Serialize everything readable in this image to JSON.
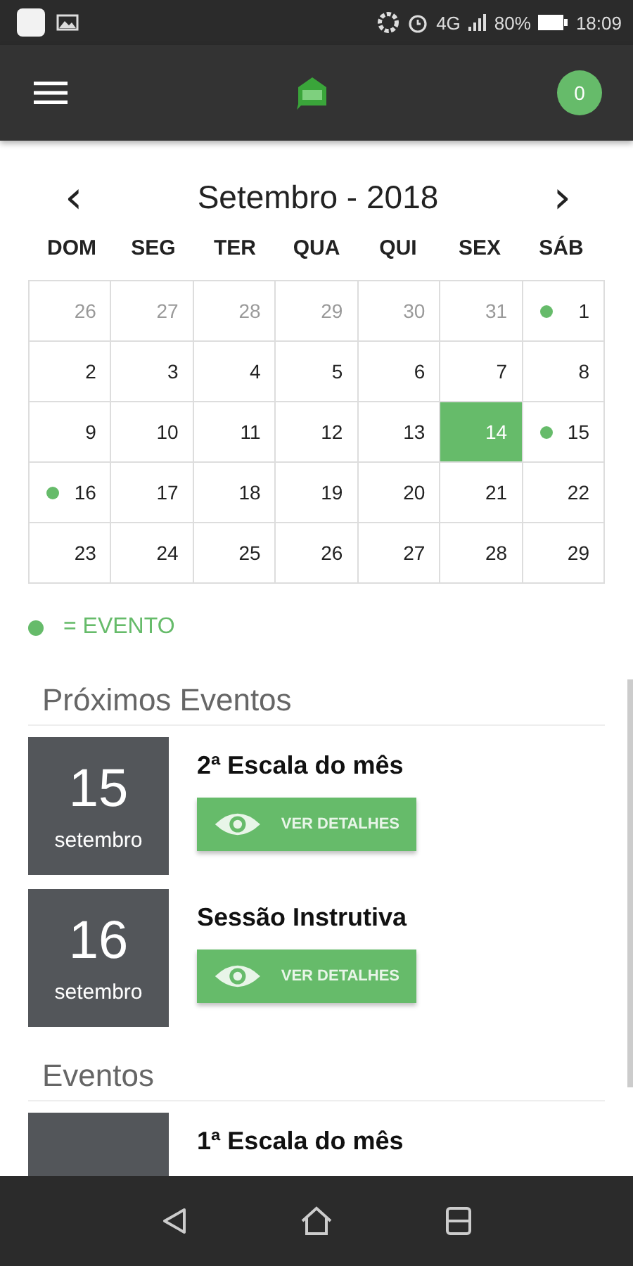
{
  "status_bar": {
    "network": "4G",
    "battery": "80%",
    "time": "18:09"
  },
  "app_bar": {
    "badge": "0"
  },
  "calendar": {
    "title": "Setembro - 2018",
    "prev": "‹",
    "next": "›",
    "weekdays": [
      "DOM",
      "SEG",
      "TER",
      "QUA",
      "QUI",
      "SEX",
      "SÁB"
    ],
    "weeks": [
      [
        {
          "day": "26",
          "muted": true,
          "selected": false,
          "event": false
        },
        {
          "day": "27",
          "muted": true,
          "selected": false,
          "event": false
        },
        {
          "day": "28",
          "muted": true,
          "selected": false,
          "event": false
        },
        {
          "day": "29",
          "muted": true,
          "selected": false,
          "event": false
        },
        {
          "day": "30",
          "muted": true,
          "selected": false,
          "event": false
        },
        {
          "day": "31",
          "muted": true,
          "selected": false,
          "event": false
        },
        {
          "day": "1",
          "muted": false,
          "selected": false,
          "event": true
        }
      ],
      [
        {
          "day": "2",
          "muted": false,
          "selected": false,
          "event": false
        },
        {
          "day": "3",
          "muted": false,
          "selected": false,
          "event": false
        },
        {
          "day": "4",
          "muted": false,
          "selected": false,
          "event": false
        },
        {
          "day": "5",
          "muted": false,
          "selected": false,
          "event": false
        },
        {
          "day": "6",
          "muted": false,
          "selected": false,
          "event": false
        },
        {
          "day": "7",
          "muted": false,
          "selected": false,
          "event": false
        },
        {
          "day": "8",
          "muted": false,
          "selected": false,
          "event": false
        }
      ],
      [
        {
          "day": "9",
          "muted": false,
          "selected": false,
          "event": false
        },
        {
          "day": "10",
          "muted": false,
          "selected": false,
          "event": false
        },
        {
          "day": "11",
          "muted": false,
          "selected": false,
          "event": false
        },
        {
          "day": "12",
          "muted": false,
          "selected": false,
          "event": false
        },
        {
          "day": "13",
          "muted": false,
          "selected": false,
          "event": false
        },
        {
          "day": "14",
          "muted": false,
          "selected": true,
          "event": false
        },
        {
          "day": "15",
          "muted": false,
          "selected": false,
          "event": true
        }
      ],
      [
        {
          "day": "16",
          "muted": false,
          "selected": false,
          "event": true
        },
        {
          "day": "17",
          "muted": false,
          "selected": false,
          "event": false
        },
        {
          "day": "18",
          "muted": false,
          "selected": false,
          "event": false
        },
        {
          "day": "19",
          "muted": false,
          "selected": false,
          "event": false
        },
        {
          "day": "20",
          "muted": false,
          "selected": false,
          "event": false
        },
        {
          "day": "21",
          "muted": false,
          "selected": false,
          "event": false
        },
        {
          "day": "22",
          "muted": false,
          "selected": false,
          "event": false
        }
      ],
      [
        {
          "day": "23",
          "muted": false,
          "selected": false,
          "event": false
        },
        {
          "day": "24",
          "muted": false,
          "selected": false,
          "event": false
        },
        {
          "day": "25",
          "muted": false,
          "selected": false,
          "event": false
        },
        {
          "day": "26",
          "muted": false,
          "selected": false,
          "event": false
        },
        {
          "day": "27",
          "muted": false,
          "selected": false,
          "event": false
        },
        {
          "day": "28",
          "muted": false,
          "selected": false,
          "event": false
        },
        {
          "day": "29",
          "muted": false,
          "selected": false,
          "event": false
        }
      ]
    ]
  },
  "legend": {
    "label": "= EVENTO"
  },
  "sections": [
    {
      "title": "Próximos Eventos",
      "events": [
        {
          "day": "15",
          "month": "setembro",
          "title": "2ª Escala do mês",
          "button": "VER DETALHES"
        },
        {
          "day": "16",
          "month": "setembro",
          "title": "Sessão Instrutiva",
          "button": "VER DETALHES"
        }
      ]
    },
    {
      "title": "Eventos",
      "events": [
        {
          "title": "1ª Escala do mês"
        }
      ]
    }
  ]
}
